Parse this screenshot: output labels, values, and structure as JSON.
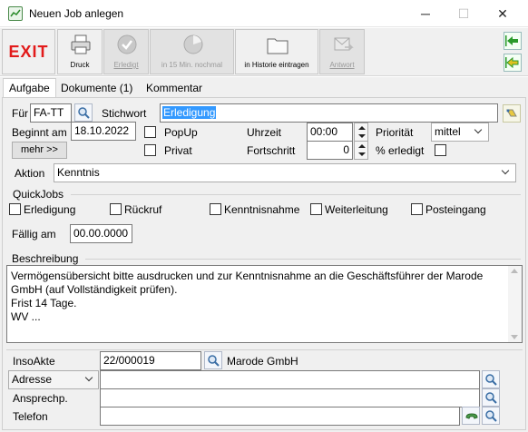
{
  "window": {
    "title": "Neuen Job anlegen",
    "minimize": "─",
    "maximize": "☐",
    "close": "✕"
  },
  "toolbar": {
    "exit": "EXIT",
    "druck": "Druck",
    "erledigt": "Erledigt",
    "nochmal": "in 15 Min. nochmal",
    "historie": "in Historie eintragen",
    "antwort": "Antwort",
    "colors": {
      "exit": "#e21b1b",
      "accent": "#2a8a2a"
    }
  },
  "tabs": [
    "Aufgabe",
    "Dokumente (1)",
    "Kommentar"
  ],
  "form": {
    "fuer_label": "Für",
    "fuer_value": "FA-TT",
    "stichwort_label": "Stichwort",
    "stichwort_value": "Erledigung",
    "beginnt_label": "Beginnt am",
    "beginnt_value": "18.10.2022",
    "mehr_button": "mehr >>",
    "popup_label": "PopUp",
    "privat_label": "Privat",
    "uhrzeit_label": "Uhrzeit",
    "uhrzeit_value": "00:00",
    "fortschritt_label": "Fortschritt",
    "fortschritt_value": "0",
    "prioritaet_label": "Priorität",
    "prioritaet_value": "mittel",
    "erledigt_pct_label": "% erledigt",
    "aktion_label": "Aktion",
    "aktion_value": "Kenntnis"
  },
  "quickjobs": {
    "title": "QuickJobs",
    "items": [
      "Erledigung",
      "Rückruf",
      "Kenntnisnahme",
      "Weiterleitung",
      "Posteingang"
    ],
    "faellig_label": "Fällig am",
    "faellig_value": "00.00.0000"
  },
  "beschreibung": {
    "title": "Beschreibung",
    "text": "Vermögensübersicht bitte ausdrucken und zur Kenntnisnahme an die Geschäftsführer der Marode\nGmbH (auf Vollständigkeit prüfen).\nFrist 14 Tage.\nWV ..."
  },
  "footer": {
    "insoakte_label": "InsoAkte",
    "insoakte_value": "22/000019",
    "insoakte_name": "Marode GmbH",
    "adresse_select": "Adresse",
    "adresse_value": "",
    "ansprech_label": "Ansprechp.",
    "ansprech_value": "",
    "telefon_label": "Telefon",
    "telefon_value": ""
  }
}
